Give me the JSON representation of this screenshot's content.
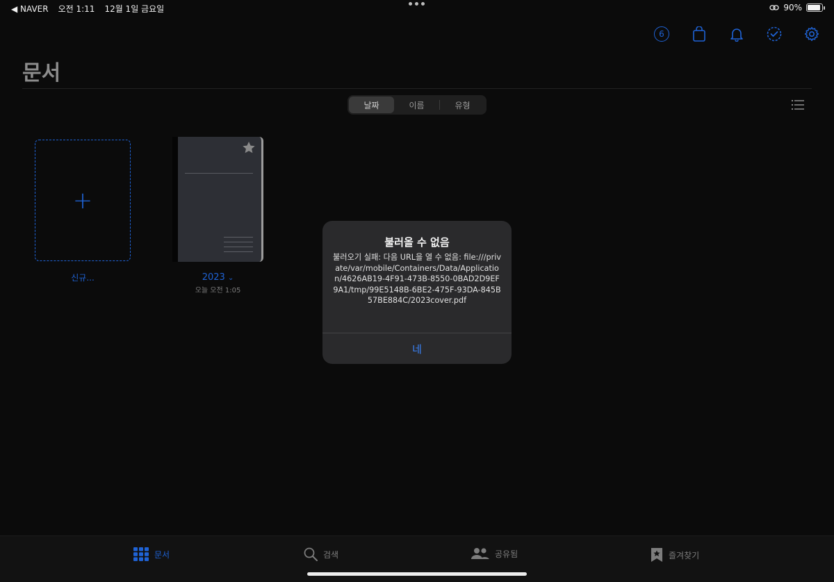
{
  "status": {
    "back_label": "◀ NAVER",
    "time": "오전 1:11",
    "date": "12월 1일 금요일",
    "battery": "90%",
    "battery_level": 0.9
  },
  "toolbar": {
    "badge_count": "6",
    "icons": [
      "badge-count-icon",
      "shopping-bag-icon",
      "bell-icon",
      "check-circle-icon",
      "gear-icon"
    ],
    "accent_color": "#1f63d6"
  },
  "page": {
    "title": "문서"
  },
  "sort": {
    "options": [
      "날짜",
      "이름",
      "유형"
    ],
    "selected": "날짜"
  },
  "documents": {
    "new_label": "신규...",
    "items": [
      {
        "title": "2023",
        "chevron": "⌄",
        "date": "오늘 오전 1:05",
        "starred": true
      }
    ]
  },
  "alert": {
    "title": "불러올 수 없음",
    "message": "불러오기 실패: 다음 URL을 열 수 없음: file:///private/var/mobile/Containers/Data/Application/4626AB19-4F91-473B-8550-0BAD2D9EF9A1/tmp/99E5148B-6BE2-475F-93DA-845B57BE884C/2023cover.pdf",
    "button": "네",
    "button_color": "#3a82f7"
  },
  "tabbar": {
    "tabs": [
      {
        "label": "문서",
        "icon": "grid-icon",
        "active": true
      },
      {
        "label": "검색",
        "icon": "search-icon",
        "active": false
      },
      {
        "label": "공유됨",
        "icon": "people-icon",
        "active": false
      },
      {
        "label": "즐겨찾기",
        "icon": "bookmark-star-icon",
        "active": false
      }
    ]
  }
}
